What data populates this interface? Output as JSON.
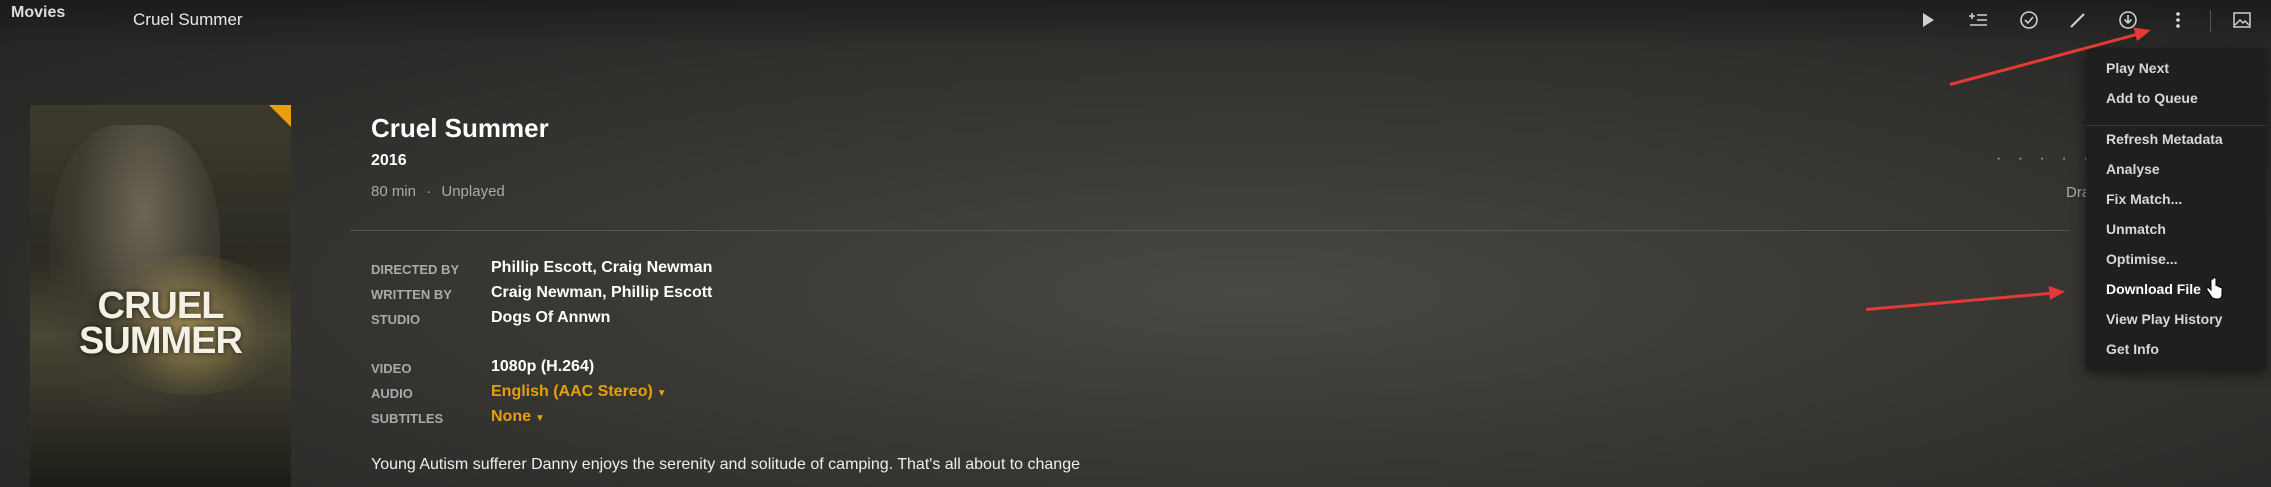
{
  "header": {
    "section": "Movies",
    "title": "Cruel Summer",
    "icons": [
      "play-icon",
      "add-to-queue-icon",
      "mark-played-icon",
      "edit-icon",
      "download-icon",
      "more-icon",
      "image-icon"
    ]
  },
  "poster": {
    "title_line1": "CRUEL",
    "title_line2": "SUMMER"
  },
  "movie": {
    "title": "Cruel Summer",
    "year": "2016",
    "duration": "80 min",
    "separator": "·",
    "status": "Unplayed",
    "dots": "· · · · ·",
    "partial_right": "Dra",
    "summary": "Young Autism sufferer Danny enjoys the serenity and solitude of camping. That's all about to change"
  },
  "details": {
    "directed_by_label": "DIRECTED BY",
    "directed_by": "Phillip Escott, Craig Newman",
    "written_by_label": "WRITTEN BY",
    "written_by": "Craig Newman, Phillip Escott",
    "studio_label": "STUDIO",
    "studio": "Dogs Of Annwn",
    "video_label": "VIDEO",
    "video": "1080p (H.264)",
    "audio_label": "AUDIO",
    "audio": "English (AAC Stereo)",
    "subtitles_label": "SUBTITLES",
    "subtitles": "None"
  },
  "menu": {
    "items": [
      "Play Next",
      "Add to Queue",
      "Refresh Metadata",
      "Analyse",
      "Fix Match...",
      "Unmatch",
      "Optimise...",
      "Download File",
      "View Play History",
      "Get Info"
    ]
  },
  "colors": {
    "accent": "#e5a00d",
    "annotation_arrow": "#e53935"
  }
}
